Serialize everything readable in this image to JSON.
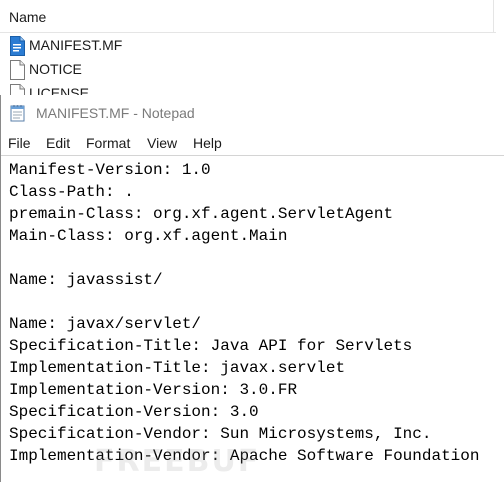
{
  "explorer": {
    "column_name": "Name",
    "files": [
      {
        "name": "MANIFEST.MF",
        "icon": "mf-file-icon"
      },
      {
        "name": "NOTICE",
        "icon": "text-file-icon"
      },
      {
        "name": "LICENSE",
        "icon": "text-file-icon"
      }
    ]
  },
  "notepad": {
    "title": "MANIFEST.MF - Notepad",
    "menu": [
      "File",
      "Edit",
      "Format",
      "View",
      "Help"
    ],
    "lines": [
      "Manifest-Version: 1.0",
      "Class-Path: .",
      "premain-Class: org.xf.agent.ServletAgent",
      "Main-Class: org.xf.agent.Main",
      "",
      "Name: javassist/",
      "",
      "Name: javax/servlet/",
      "Specification-Title: Java API for Servlets",
      "Implementation-Title: javax.servlet",
      "Implementation-Version: 3.0.FR",
      "Specification-Version: 3.0",
      "Specification-Vendor: Sun Microsystems, Inc.",
      "Implementation-Vendor: Apache Software Foundation"
    ]
  },
  "watermark": "FREEBUF"
}
